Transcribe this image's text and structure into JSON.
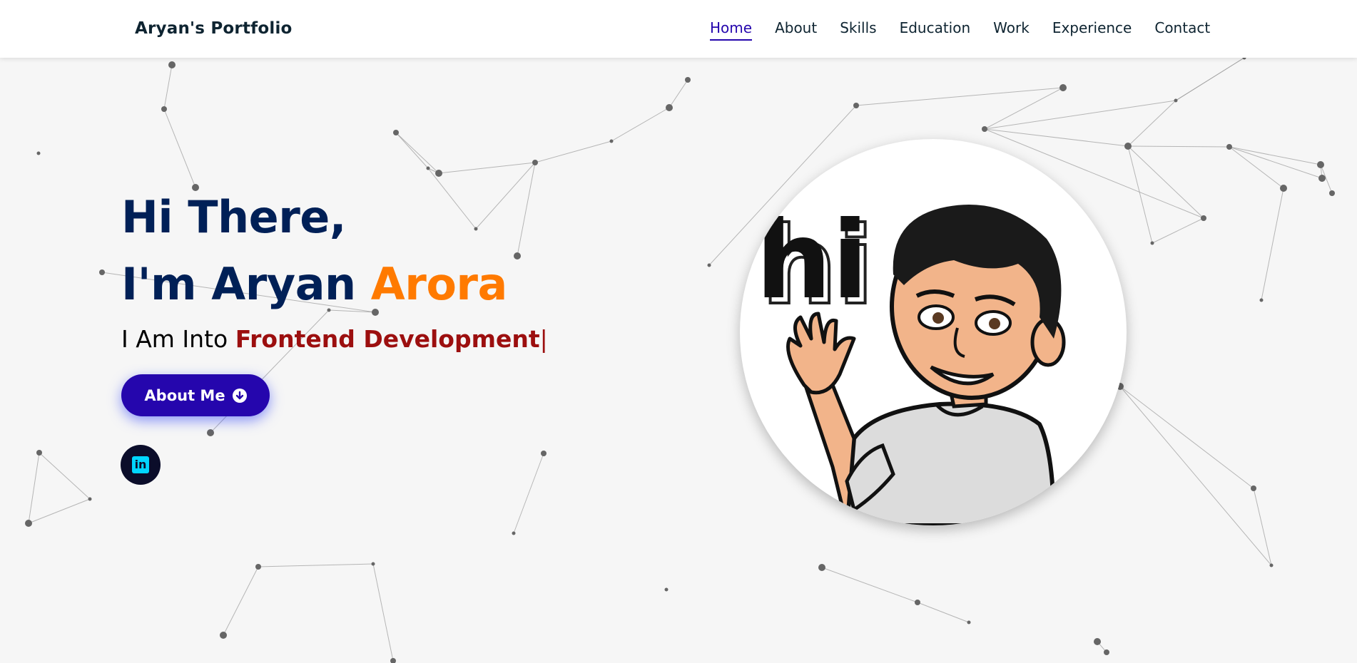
{
  "brand": {
    "title": "Aryan's Portfolio"
  },
  "nav": {
    "items": [
      {
        "label": "Home",
        "active": true
      },
      {
        "label": "About"
      },
      {
        "label": "Skills"
      },
      {
        "label": "Education"
      },
      {
        "label": "Work"
      },
      {
        "label": "Experience"
      },
      {
        "label": "Contact"
      }
    ]
  },
  "hero": {
    "line1": "Hi There,",
    "line2_prefix": "I'm Aryan ",
    "line2_accent": "Arora",
    "typed_prefix": "I Am Into ",
    "typed_role": "Frontend Development",
    "typed_cursor": "|",
    "cta_label": "About Me",
    "cta_icon": "arrow-down-circle-icon",
    "social": [
      {
        "icon": "linkedin-icon",
        "glyph": "in"
      }
    ],
    "avatar_word": "hi"
  },
  "colors": {
    "navy": "#002057",
    "accent_orange": "#ff7a00",
    "role_red": "#9c0f0f",
    "button_blue": "#2506ad",
    "nav_active": "#2506ad",
    "background": "#f6f6f6"
  }
}
